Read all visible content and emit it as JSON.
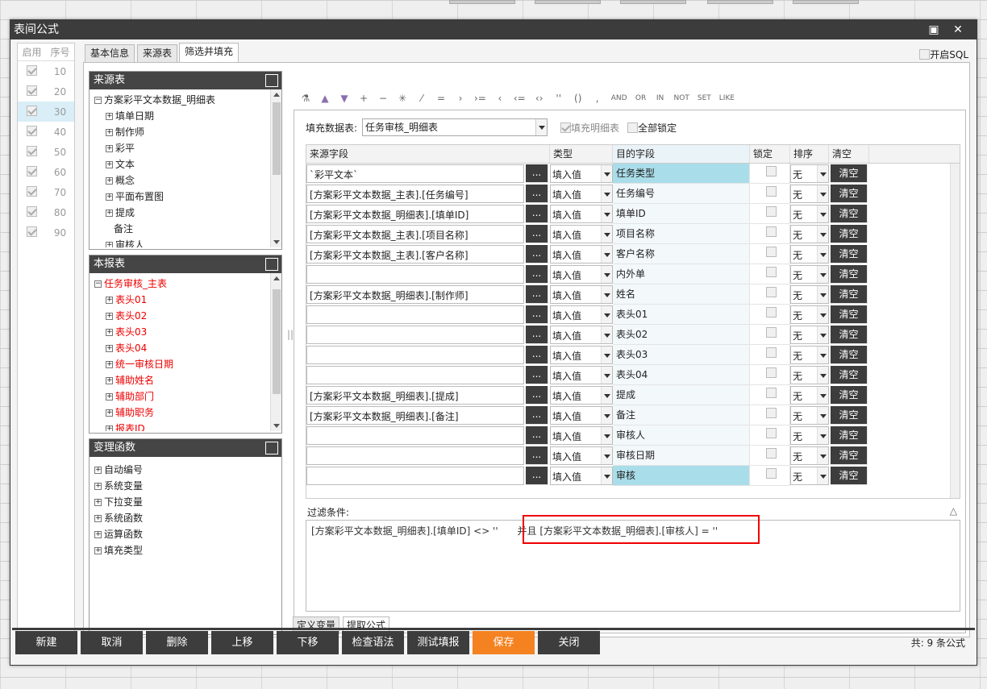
{
  "window": {
    "title": "表间公式"
  },
  "seq_panel": {
    "headers": [
      "启用",
      "序号"
    ],
    "rows": [
      {
        "num": "10",
        "selected": false
      },
      {
        "num": "20",
        "selected": false
      },
      {
        "num": "30",
        "selected": true
      },
      {
        "num": "40",
        "selected": false
      },
      {
        "num": "50",
        "selected": false
      },
      {
        "num": "60",
        "selected": false
      },
      {
        "num": "70",
        "selected": false
      },
      {
        "num": "80",
        "selected": false
      },
      {
        "num": "90",
        "selected": false
      }
    ]
  },
  "tabs": [
    "基本信息",
    "来源表",
    "筛选并填充"
  ],
  "open_sql_label": "开启SQL",
  "source_table": {
    "title": "来源表",
    "root": "方案彩平文本数据_明细表",
    "children": [
      "填单日期",
      "制作师",
      "彩平",
      "文本",
      "概念",
      "平面布置图",
      "提成",
      "备注",
      "审核人"
    ]
  },
  "this_table": {
    "title": "本报表",
    "root": "任务审核_主表",
    "children": [
      "表头01",
      "表头02",
      "表头03",
      "表头04",
      "统一审核日期",
      "辅助姓名",
      "辅助部门",
      "辅助职务",
      "报表ID"
    ]
  },
  "variables": {
    "title": "变理函数",
    "items": [
      "自动编号",
      "系统变量",
      "下拉变量",
      "系统函数",
      "运算函数",
      "填充类型"
    ]
  },
  "toolbar": {
    "ops": [
      "+",
      "−",
      "✳",
      "⁄",
      "=",
      "›",
      "›=",
      "‹",
      "‹=",
      "‹›",
      "''",
      "()",
      ","
    ],
    "words": [
      "AND",
      "OR",
      "IN",
      "NOT",
      "SET",
      "LIKE"
    ]
  },
  "fill": {
    "label": "填充数据表:",
    "table": "任务审核_明细表",
    "fill_detail_label": "填充明细表",
    "lock_all_label": "全部锁定"
  },
  "grid": {
    "headers": [
      "来源字段",
      "类型",
      "目的字段",
      "锁定",
      "排序",
      "清空"
    ],
    "dot_label": "...",
    "rows": [
      {
        "src": "`彩平文本`",
        "type": "填入值",
        "target": "任务类型",
        "sort": "无",
        "clear": "清空",
        "hl": true
      },
      {
        "src": "[方案彩平文本数据_主表].[任务编号]",
        "type": "填入值",
        "target": "任务编号",
        "sort": "无",
        "clear": "清空",
        "hl": false
      },
      {
        "src": "[方案彩平文本数据_明细表].[填单ID]",
        "type": "填入值",
        "target": "填单ID",
        "sort": "无",
        "clear": "清空",
        "hl": false
      },
      {
        "src": "[方案彩平文本数据_主表].[项目名称]",
        "type": "填入值",
        "target": "项目名称",
        "sort": "无",
        "clear": "清空",
        "hl": false
      },
      {
        "src": "[方案彩平文本数据_主表].[客户名称]",
        "type": "填入值",
        "target": "客户名称",
        "sort": "无",
        "clear": "清空",
        "hl": false
      },
      {
        "src": "",
        "type": "填入值",
        "target": "内外单",
        "sort": "无",
        "clear": "清空",
        "hl": false
      },
      {
        "src": "[方案彩平文本数据_明细表].[制作师]",
        "type": "填入值",
        "target": "姓名",
        "sort": "无",
        "clear": "清空",
        "hl": false
      },
      {
        "src": "",
        "type": "填入值",
        "target": "表头01",
        "sort": "无",
        "clear": "清空",
        "hl": false
      },
      {
        "src": "",
        "type": "填入值",
        "target": "表头02",
        "sort": "无",
        "clear": "清空",
        "hl": false
      },
      {
        "src": "",
        "type": "填入值",
        "target": "表头03",
        "sort": "无",
        "clear": "清空",
        "hl": false
      },
      {
        "src": "",
        "type": "填入值",
        "target": "表头04",
        "sort": "无",
        "clear": "清空",
        "hl": false
      },
      {
        "src": "[方案彩平文本数据_明细表].[提成]",
        "type": "填入值",
        "target": "提成",
        "sort": "无",
        "clear": "清空",
        "hl": false
      },
      {
        "src": "[方案彩平文本数据_明细表].[备注]",
        "type": "填入值",
        "target": "备注",
        "sort": "无",
        "clear": "清空",
        "hl": false
      },
      {
        "src": "",
        "type": "填入值",
        "target": "审核人",
        "sort": "无",
        "clear": "清空",
        "hl": false
      },
      {
        "src": "",
        "type": "填入值",
        "target": "审核日期",
        "sort": "无",
        "clear": "清空",
        "hl": false
      },
      {
        "src": "",
        "type": "填入值",
        "target": "审核",
        "sort": "无",
        "clear": "清空",
        "hl": true
      }
    ]
  },
  "filter": {
    "label": "过滤条件:",
    "part1": "[方案彩平文本数据_明细表].[填单ID]  <>  ''",
    "part2": "并且  [方案彩平文本数据_明细表].[审核人]  =  ''"
  },
  "bottom_tabs": [
    "定义变量",
    "提取公式"
  ],
  "buttons": [
    "新建",
    "取消",
    "删除",
    "上移",
    "下移",
    "检查语法",
    "测试填报",
    "保存",
    "关闭"
  ],
  "count_text": "共: 9 条公式"
}
